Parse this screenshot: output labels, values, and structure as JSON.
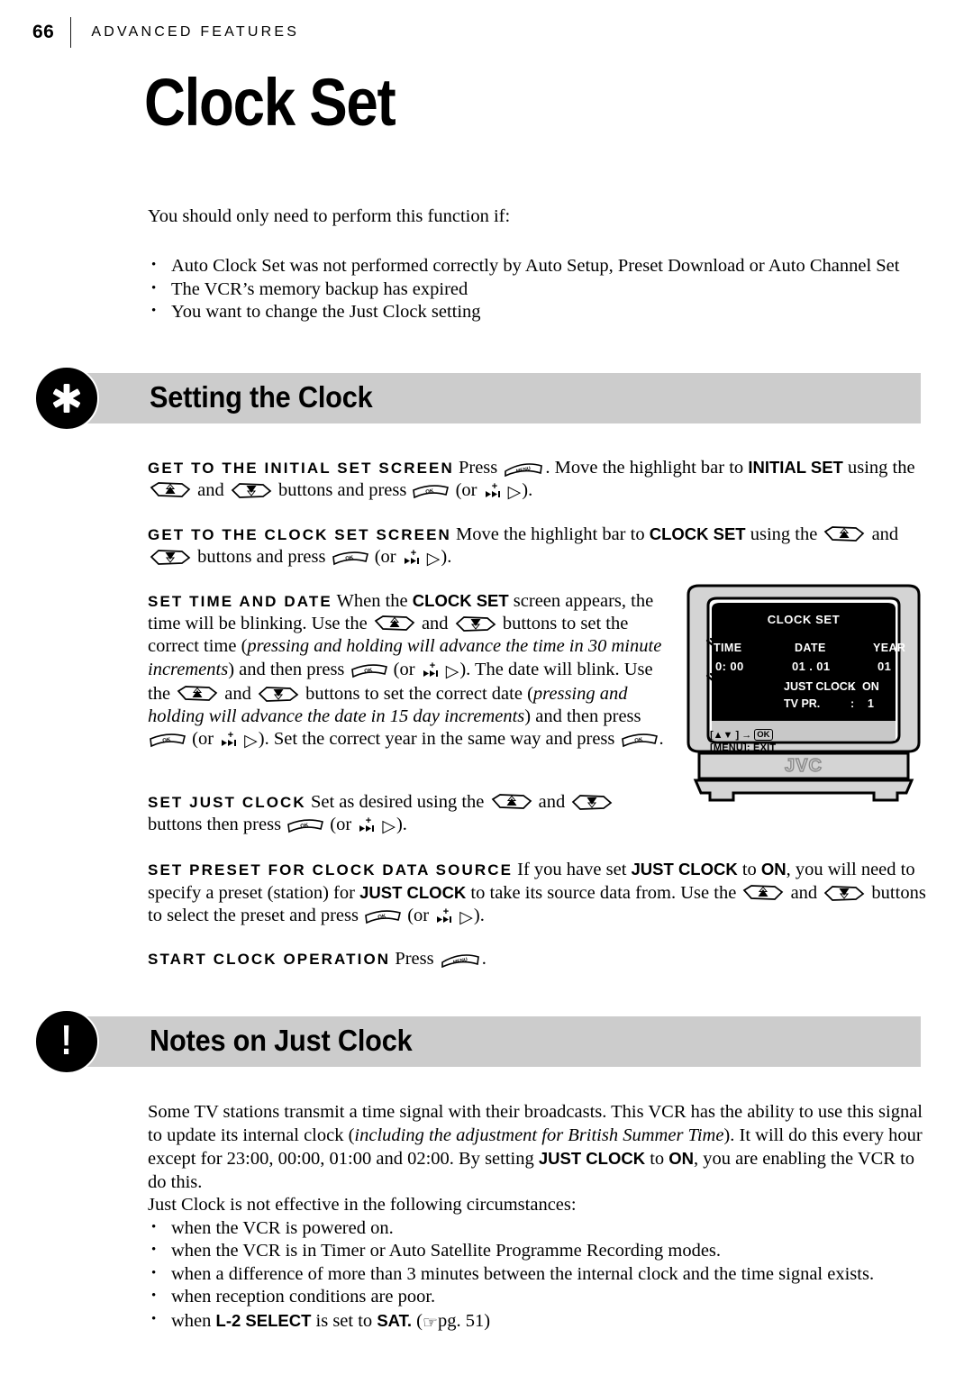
{
  "header": {
    "folio": "66",
    "running_title": "ADVANCED FEATURES"
  },
  "chapter_title": "Clock Set",
  "intro": {
    "lead": "You should only need to perform this function if:",
    "bullets": [
      "Auto Clock Set was not performed correctly by Auto Setup, Preset Download or Auto Channel Set",
      "The VCR’s memory backup has expired",
      "You want to change the Just Clock setting"
    ]
  },
  "sections": [
    {
      "icon": "asterisk-icon",
      "label": "Setting the Clock"
    },
    {
      "icon": "exclamation-icon",
      "label": "Notes on Just Clock"
    }
  ],
  "steps": [
    {
      "tag": "GET TO THE INITIAL SET SCREEN",
      "t1": "Press",
      "key1": "menu-button-icon",
      "t2": ". Move the highlight bar to",
      "kw1": "INITIAL SET",
      "t3": "using the",
      "key2": "up-rocker-button-icon",
      "t4": "and",
      "key3": "down-rocker-button-icon",
      "t5": "buttons and press",
      "key4": "ok-button-icon",
      "t6": "(or",
      "key5": "fast-forward-plus-icon",
      "key6": "▷",
      "t7": ")."
    },
    {
      "tag": "GET TO THE CLOCK SET SCREEN",
      "t1": "Move the highlight bar to",
      "kw1": "CLOCK SET",
      "t2": "using the",
      "t3": "and",
      "t4": "buttons and press",
      "t5": "(or",
      "t6": ")."
    },
    {
      "tag": "SET TIME AND DATE",
      "p1": "When the",
      "kw1": "CLOCK SET",
      "p2": "screen appears, the time will be blinking. Use the",
      "p3": "and",
      "p4": "buttons to set the correct time (",
      "i1": "pressing and holding will advance the time in 30 minute increments",
      "p5": ") and then press",
      "p6": "(or",
      "p7": "). The date will blink. Use the",
      "p8": "and",
      "p9": "buttons to set the correct date (",
      "i2": "pressing and holding will advance the date in 15 day increments",
      "p10": ") and then press",
      "p11": "(or",
      "p12": "). Set the correct year in the same way and press",
      "p13": "."
    },
    {
      "tag": "SET JUST CLOCK",
      "t1": "Set as desired using the",
      "t2": "and",
      "t3": "buttons then press",
      "t4": "(or",
      "t5": ")."
    },
    {
      "tag": "SET PRESET FOR CLOCK DATA SOURCE",
      "t1": "If you have set",
      "kw1": "JUST CLOCK",
      "t2": "to",
      "kw2": "ON",
      "t3": ", you will need to specify a preset (station) for",
      "kw3": "JUST CLOCK",
      "t4": "to take its source data from. Use the",
      "t5": "and",
      "t6": "buttons to select the preset and press",
      "t7": "(or",
      "t8": ")."
    },
    {
      "tag": "START CLOCK OPERATION",
      "t1": "Press",
      "t2": "."
    }
  ],
  "tv_illustration": {
    "brand": "JVC",
    "osd": {
      "title": "CLOCK SET",
      "col_time": "TIME",
      "col_date": "DATE",
      "col_year": "YEAR",
      "val_time": "0: 00",
      "val_date": "01 . 01",
      "val_year": "01",
      "row_just_clock_label": "JUST CLOCK",
      "row_just_clock_colon": ":",
      "row_just_clock_value": "ON",
      "row_tv_pr_label": "TV PR.",
      "row_tv_pr_colon": ":",
      "row_tv_pr_value": "1",
      "footer_nav": "[▲▼ ] →",
      "footer_nav_key": "OK",
      "footer_exit": "[MENU]: EXIT"
    }
  },
  "notes": {
    "p1": "Some TV stations transmit a time signal with their broadcasts. This VCR has the ability to use this signal to update its internal clock (",
    "p1_italic": "including the adjustment for British Summer Time",
    "p2": "). It will do this every hour except for 23:00, 00:00, 01:00 and 02:00. By setting",
    "kw1": "JUST CLOCK",
    "p3": "to",
    "kw2": "ON",
    "p4": ", you are enabling the VCR to do this.",
    "lead": "Just Clock is not effective in the following circumstances:",
    "bullets": [
      "when the VCR is powered on.",
      "when the VCR is in Timer or Auto Satellite Programme Recording modes.",
      "when a difference of more than 3 minutes between the internal clock and the time signal exists.",
      "when reception conditions are poor."
    ],
    "last_bullet": {
      "t1": "when",
      "kw1": "L-2 SELECT",
      "t2": "is set to",
      "kw2": "SAT.",
      "t3": "(",
      "hand": "☞",
      "t4": "pg. 51)"
    }
  },
  "colors": {
    "section_bar": "#cccccc",
    "icon_fill": "#000000",
    "tv_body": "#d4d4d4",
    "osd_background": "#000000"
  }
}
